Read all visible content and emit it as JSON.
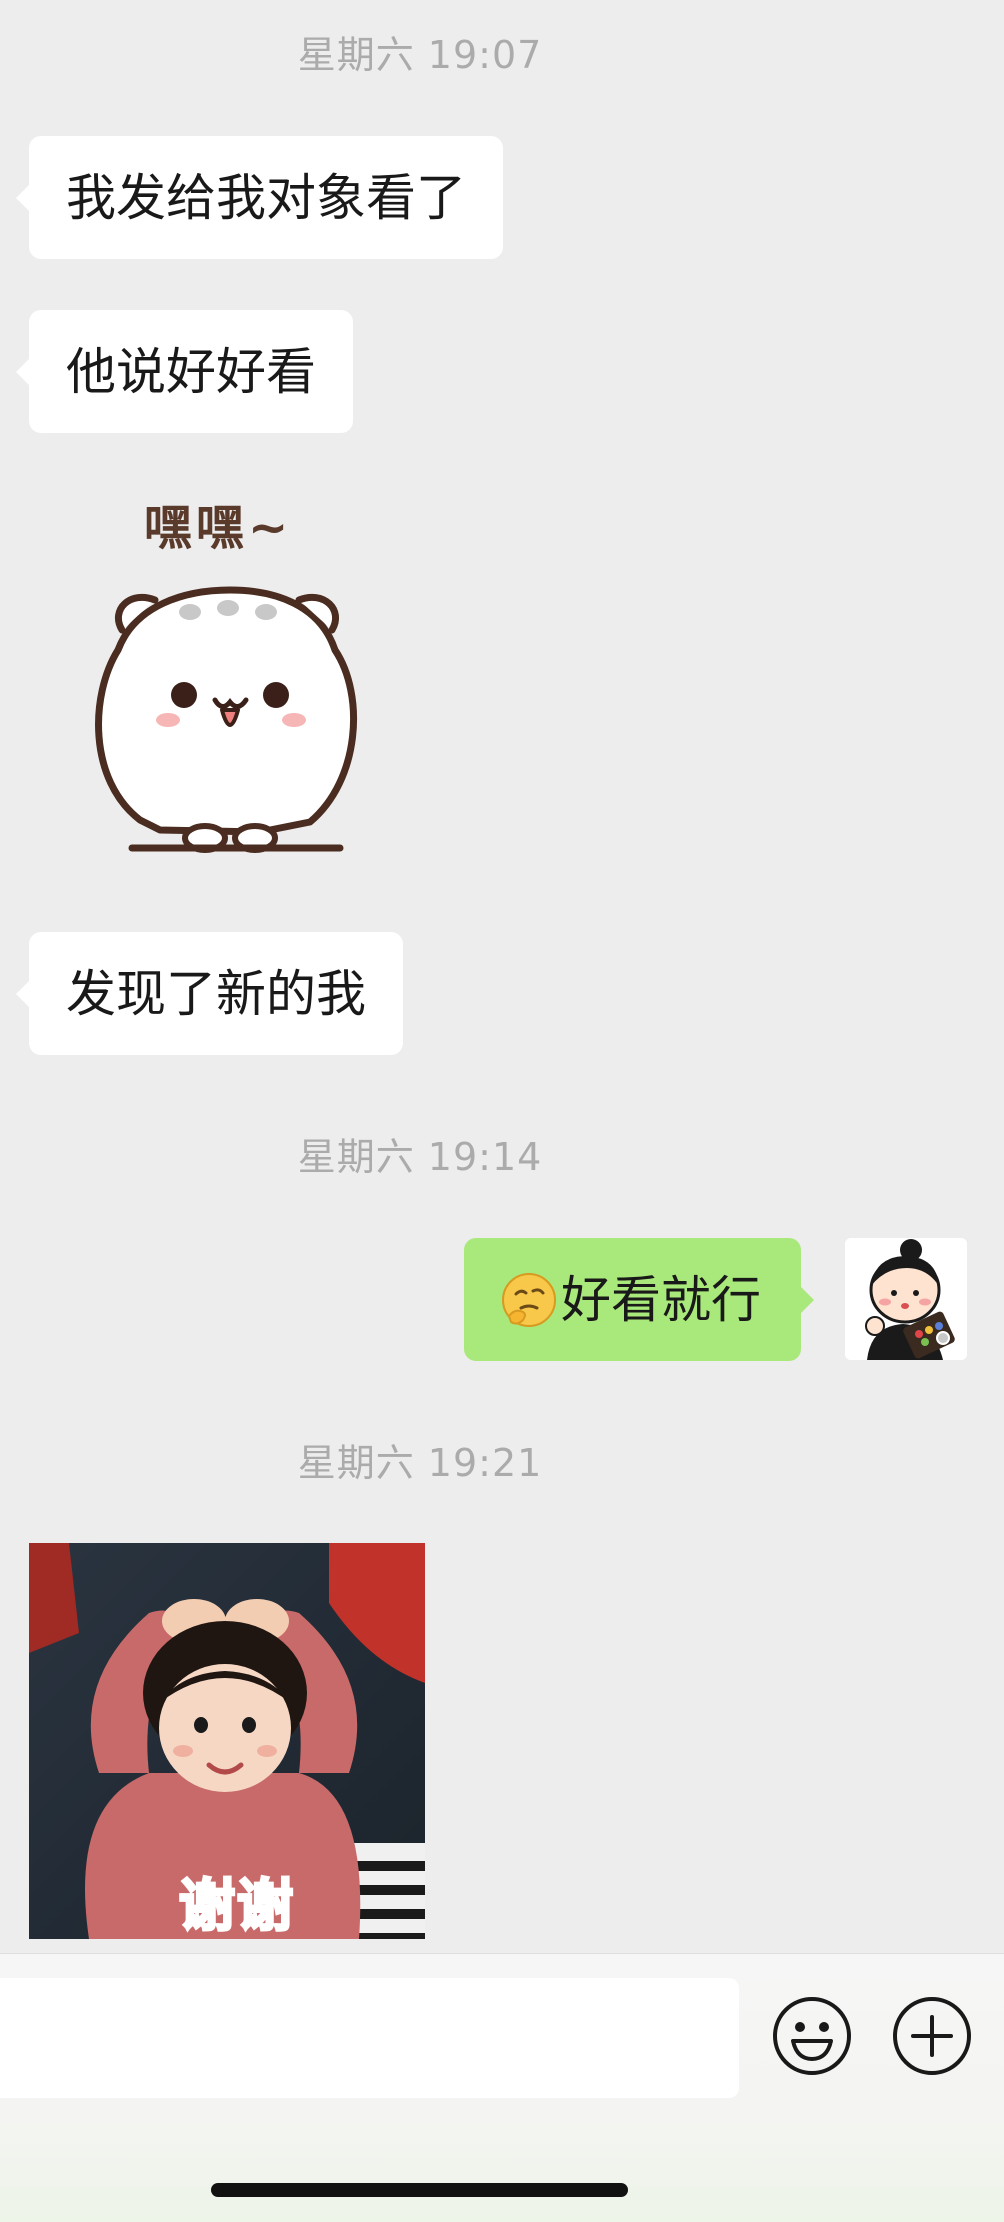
{
  "chat": {
    "timestamps": {
      "t1": "星期六 19:07",
      "t2": "星期六 19:14",
      "t3": "星期六 19:21"
    },
    "messages": {
      "m1": "我发给我对象看了",
      "m2": "他说好好看",
      "m3": "发现了新的我",
      "m4": "好看就行",
      "sticker_text": "嘿嘿~",
      "photo_caption": "谢谢"
    }
  },
  "input": {
    "placeholder": ""
  },
  "icons": {
    "emoji_button": "smiley-icon",
    "more_button": "plus-circle-icon"
  },
  "colors": {
    "background": "#ededed",
    "incoming_bubble": "#ffffff",
    "outgoing_bubble": "#a9e87a",
    "timestamp": "#ababab"
  }
}
